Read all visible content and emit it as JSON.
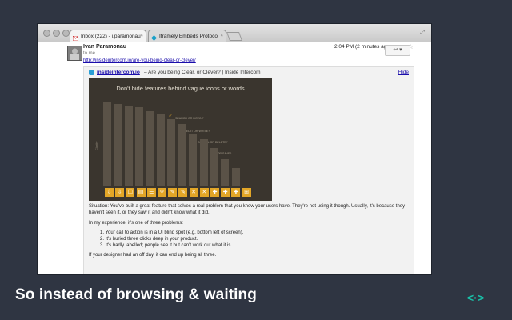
{
  "browser": {
    "tabs": [
      {
        "label": "Inbox (222) - i.paramonau",
        "favicon": "gmail-icon"
      },
      {
        "label": "Iframely Embeds Protocol",
        "favicon": "iframely-icon"
      }
    ],
    "close_glyph": "×"
  },
  "email": {
    "sender": "Ivan Paramonau",
    "to": "to me",
    "date": "2:04 PM (2 minutes ago)",
    "reply_glyph": "↩ ▾",
    "star_glyph": "☆",
    "link": "http://insideintercom.io/are-you-being-clear-or-clever/",
    "card": {
      "source": "insideintercom.io",
      "title": "– Are you being Clear, or Clever? | Inside Intercom",
      "hide": "Hide",
      "slide": {
        "title": "Don't hide features behind vague icons or words",
        "ylabel": "Clarity",
        "annotations": [
          "SEARCH OR DOWN?",
          "EDIT OR WRITE?",
          "CANCEL OR DELETE?",
          "ADD OR SAVE?"
        ],
        "bar_levels": [
          100,
          98,
          96,
          94,
          90,
          86,
          80,
          74,
          62,
          56,
          46,
          32,
          22
        ],
        "icons": [
          "⇩",
          "⇩",
          "☐",
          "▤",
          "☰",
          "⚲",
          "✎",
          "✎",
          "✕",
          "✕",
          "✚",
          "✚",
          "✚",
          "⊞"
        ]
      },
      "paragraph1": "Situation: You've built a great feature that solves a real problem that you know your users have. They're not using it though. Usually, it's because they haven't seen it, or they saw it and didn't know what it did.",
      "paragraph2": "In my experience, it's one of three problems:",
      "list": [
        "1.  Your call to action is in a UI blind spot (e.g. bottom left of screen).",
        "2.  It's buried three clicks deep in your product.",
        "3.  It's badly labelled; people see it but can't work out what it is."
      ],
      "paragraph3": "If your designer had an off day, it can end up being all three."
    }
  },
  "caption": "So instead of browsing & waiting",
  "logo": "<·>"
}
